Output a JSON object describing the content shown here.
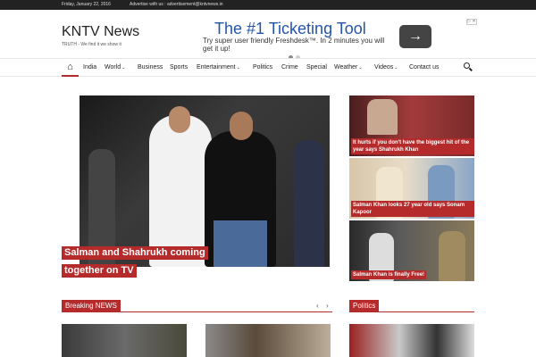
{
  "topbar": {
    "date": "Friday, January 22, 2016",
    "advertise": "Advertise with us : advertisement@kntvnews.in"
  },
  "site": {
    "name": "KNTV News",
    "tagline": "TRUTH - We find it we show it"
  },
  "ad": {
    "title": "The #1 Ticketing Tool",
    "subtitle": "Try super user friendly Freshdesk™. In 2 minutes you will get it up!",
    "arrow_icon": "arrow-right-icon",
    "badge": "▷ ✕"
  },
  "nav": {
    "items": [
      {
        "label": "India",
        "dropdown": false
      },
      {
        "label": "World",
        "dropdown": true
      },
      {
        "label": "Business",
        "dropdown": false
      },
      {
        "label": "Sports",
        "dropdown": false
      },
      {
        "label": "Entertainment",
        "dropdown": true
      },
      {
        "label": "Politics",
        "dropdown": false
      },
      {
        "label": "Crime",
        "dropdown": false
      },
      {
        "label": "Special",
        "dropdown": false
      },
      {
        "label": "Weather",
        "dropdown": true
      },
      {
        "label": "Videos",
        "dropdown": true
      },
      {
        "label": "Contact us",
        "dropdown": false
      }
    ],
    "home_icon": "home-icon",
    "search_icon": "search-icon",
    "caret": "⌄"
  },
  "feature": {
    "caption_line1": "Salman and Shahrukh coming",
    "caption_line2": "together on TV"
  },
  "side_stories": [
    {
      "caption": "It hurts if you don't have the biggest hit of the year says Shahrukh Khan"
    },
    {
      "caption": "Salman Khan looks 27 year old says Sonam Kapoor"
    },
    {
      "caption": "Salman Khan is finally Free!"
    }
  ],
  "sections": {
    "breaking": "Breaking NEWS",
    "politics": "Politics",
    "prev": "‹",
    "next": "›"
  },
  "colors": {
    "accent": "#b52a2a",
    "topbar": "#222222"
  }
}
